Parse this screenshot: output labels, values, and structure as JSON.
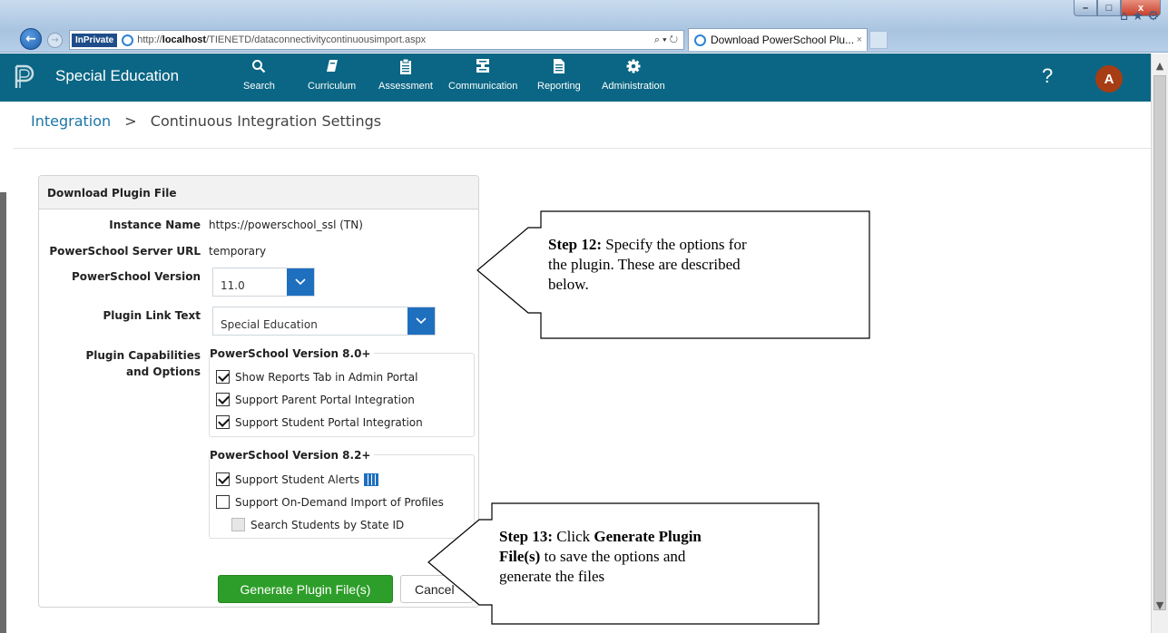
{
  "browser": {
    "inprivate_label": "InPrivate",
    "url_prefix": "http://",
    "url_host": "localhost",
    "url_path": "/TIENETD/dataconnectivitycontinuousimport.aspx",
    "address_tools": "⌕ ▾ ↻",
    "tab_title": "Download PowerSchool Plu...",
    "tab_close": "×",
    "window_min": "–",
    "window_max": "□",
    "window_close": "x",
    "tools_icons": "⌂ ★ ⚙"
  },
  "app": {
    "name": "Special Education",
    "nav": [
      {
        "label": "Search",
        "icon": "search-icon"
      },
      {
        "label": "Curriculum",
        "icon": "book-icon"
      },
      {
        "label": "Assessment",
        "icon": "clipboard-icon"
      },
      {
        "label": "Communication",
        "icon": "server-icon"
      },
      {
        "label": "Reporting",
        "icon": "document-icon"
      },
      {
        "label": "Administration",
        "icon": "gear-icon"
      }
    ],
    "help": "?",
    "avatar_initial": "A",
    "header_color": "#0a6684",
    "avatar_color": "#a63d14"
  },
  "breadcrumb": {
    "parent": "Integration",
    "separator": ">",
    "current": "Continuous Integration Settings"
  },
  "panel": {
    "title": "Download Plugin File",
    "instance_label": "Instance Name",
    "instance_value": "https://powerschool_ssl (TN)",
    "server_label": "PowerSchool Server URL",
    "server_value": "temporary",
    "version_label": "PowerSchool Version",
    "version_value": "11.0",
    "link_text_label": "Plugin Link Text",
    "link_text_value": "Special Education",
    "capabilities_label_1": "Plugin Capabilities",
    "capabilities_label_2": "and Options",
    "group1_title": "PowerSchool Version 8.0+",
    "group1_items": [
      {
        "label": "Show Reports Tab in Admin Portal",
        "checked": true
      },
      {
        "label": "Support Parent Portal Integration",
        "checked": true
      },
      {
        "label": "Support Student Portal Integration",
        "checked": true
      }
    ],
    "group2_title": "PowerSchool Version 8.2+",
    "group2_items": [
      {
        "label": "Support Student Alerts",
        "checked": true
      },
      {
        "label": "Support On-Demand Import of Profiles",
        "checked": false
      },
      {
        "label": "Search Students by State ID",
        "checked": false,
        "disabled": true
      }
    ],
    "generate_button": "Generate Plugin File(s)",
    "cancel_button": "Cancel",
    "accent_color": "#1f6fbf",
    "generate_color": "#2e9e2a"
  },
  "callouts": {
    "step12_label": "Step 12:",
    "step12_text_1": " Specify the options for",
    "step12_text_2": "the plugin. These are described",
    "step12_text_3": "below.",
    "step13_label": "Step 13:",
    "step13_click": " Click ",
    "step13_bold": "Generate Plugin",
    "step13_bold2": "File(s)",
    "step13_text_2": " to save the options and",
    "step13_text_3": "generate the files"
  }
}
